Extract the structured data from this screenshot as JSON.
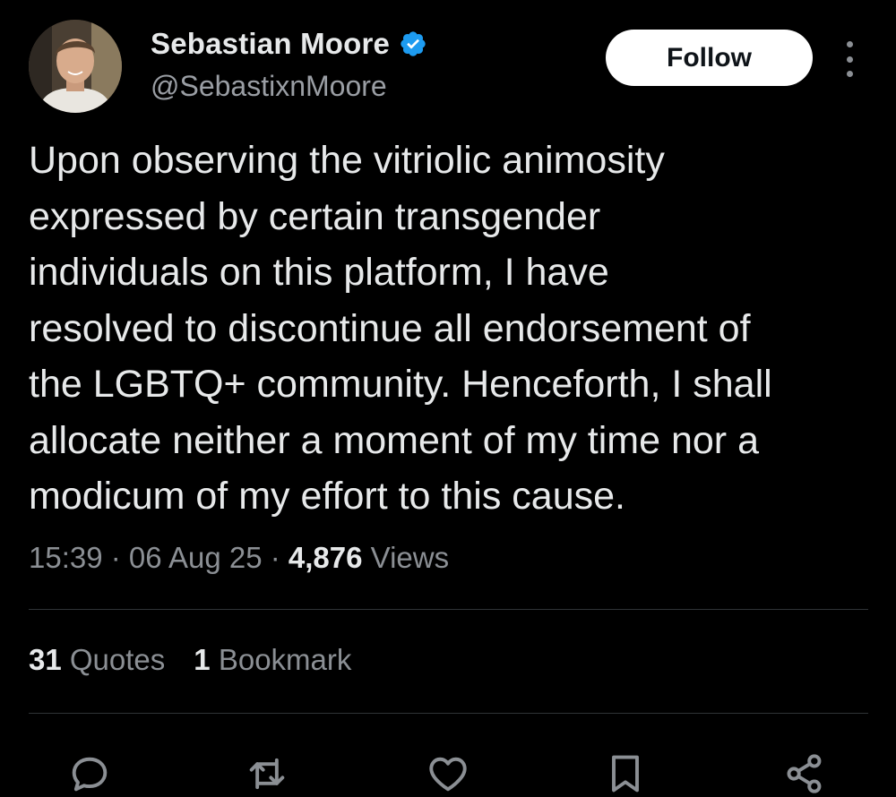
{
  "author": {
    "display_name": "Sebastian Moore",
    "handle": "@SebastixnMoore",
    "verified": true,
    "avatar_icon": "profile-photo"
  },
  "follow_button": {
    "label": "Follow"
  },
  "more_icon": "more-vertical-icon",
  "tweet": {
    "text": "Upon observing the vitriolic animosity\nexpressed by certain transgender\nindividuals on this platform, I have\nresolved to discontinue all endorsement of\nthe LGBTQ+ community. Henceforth, I shall\nallocate neither a moment of my time nor a\nmodicum of my effort to this cause."
  },
  "meta": {
    "time": "15:39",
    "separator": " · ",
    "date": "06 Aug 25",
    "views_count": "4,876",
    "views_label": " Views"
  },
  "stats": [
    {
      "count": "31",
      "label": " Quotes"
    },
    {
      "count": "1",
      "label": " Bookmark"
    }
  ],
  "actions": [
    "reply-icon",
    "retweet-icon",
    "like-icon",
    "bookmark-icon",
    "share-icon"
  ],
  "colors": {
    "background": "#000000",
    "text": "#e7e9ea",
    "secondary": "#8b8f94",
    "verified": "#1d9bf0",
    "divider": "#2f3336",
    "button_bg": "#ffffff"
  }
}
